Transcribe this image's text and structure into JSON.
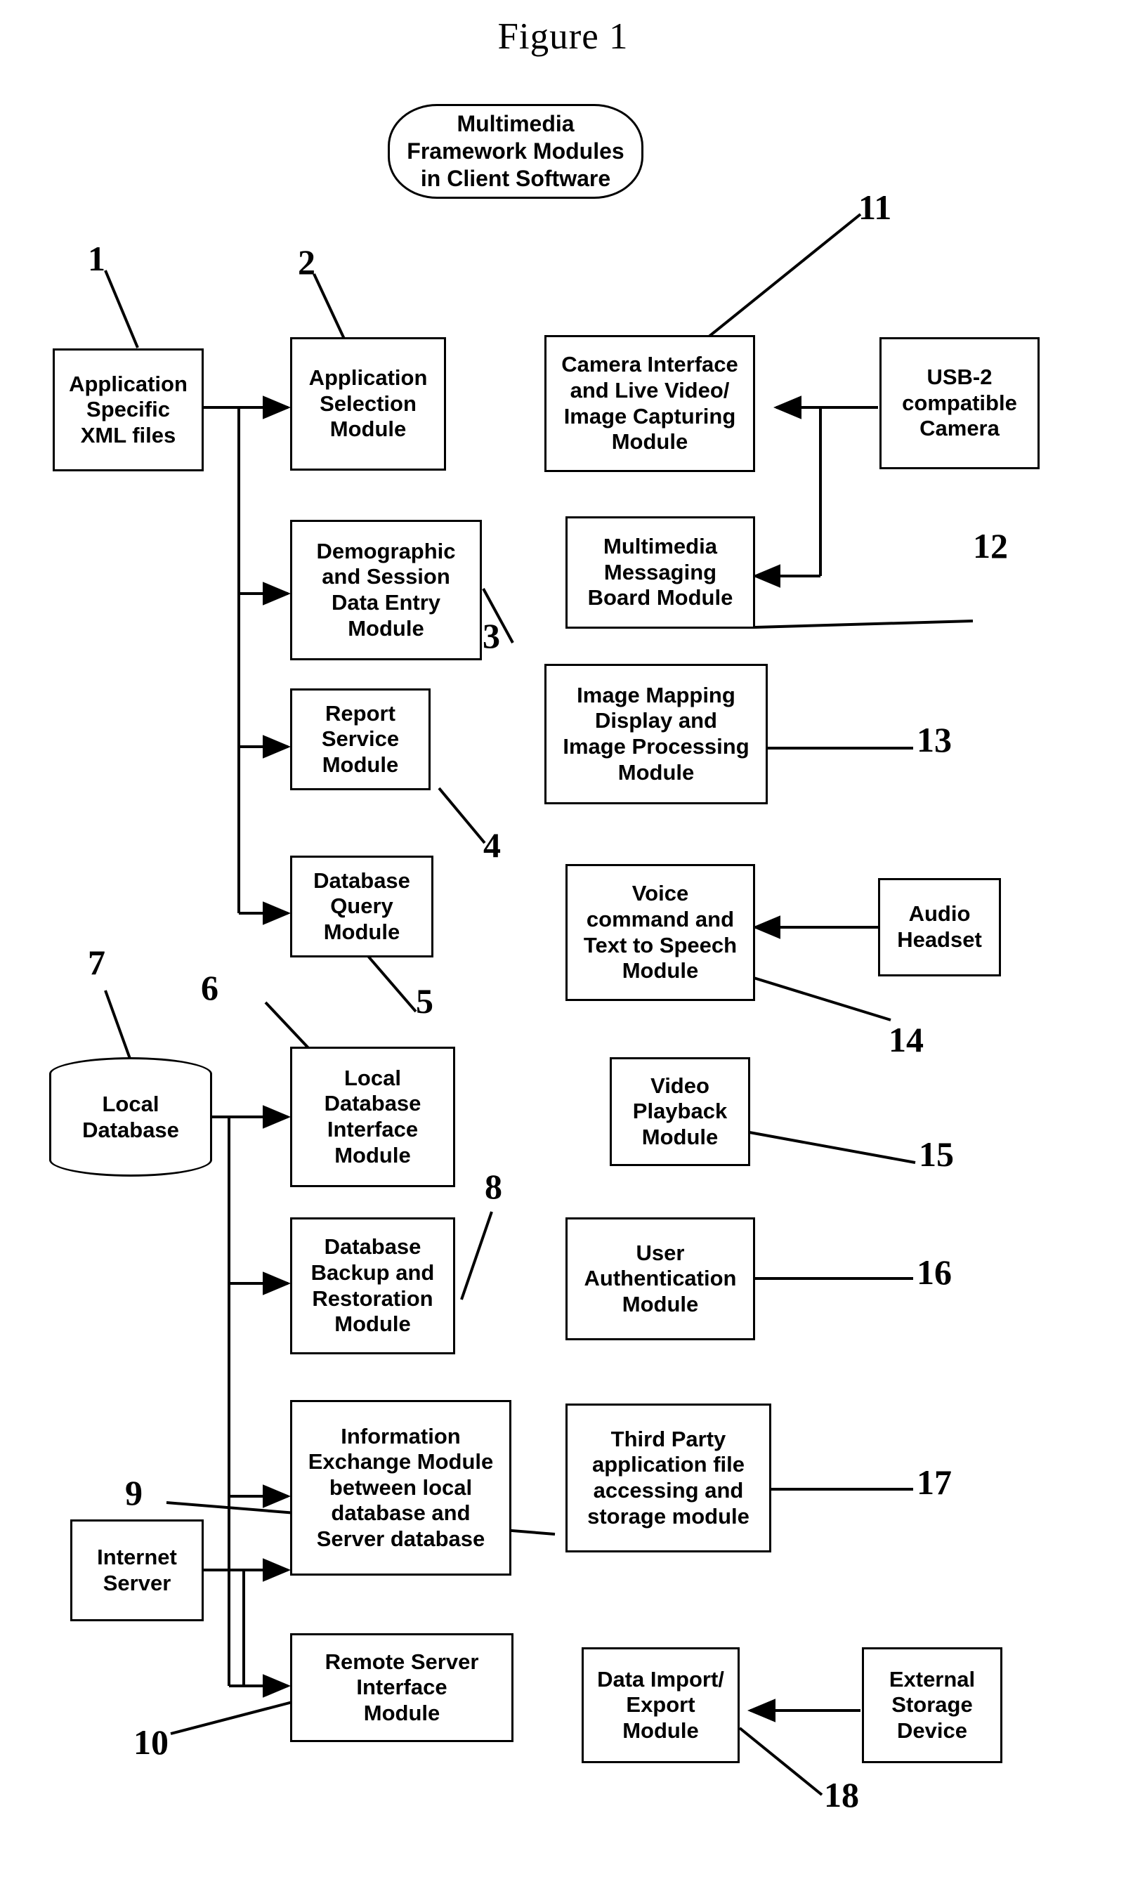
{
  "figure": {
    "title": "Figure 1"
  },
  "header_node": {
    "label": "Multimedia\nFramework Modules\nin Client Software"
  },
  "nodes": [
    {
      "id": "application-specific-xml-files",
      "label": "Application\nSpecific\nXML files",
      "shape": "rect"
    },
    {
      "id": "application-selection-module",
      "label": "Application\nSelection\nModule",
      "shape": "rect"
    },
    {
      "id": "demographic-and-session-data-entry-module",
      "label": "Demographic\nand Session\nData Entry\nModule",
      "shape": "rect"
    },
    {
      "id": "report-service-module",
      "label": "Report\nService\nModule",
      "shape": "rect"
    },
    {
      "id": "database-query-module",
      "label": "Database\nQuery\nModule",
      "shape": "rect"
    },
    {
      "id": "local-database",
      "label": "Local\nDatabase",
      "shape": "cylinder"
    },
    {
      "id": "local-database-interface-module",
      "label": "Local\nDatabase\nInterface\nModule",
      "shape": "rect"
    },
    {
      "id": "database-backup-and-restoration-module",
      "label": "Database\nBackup and\nRestoration\nModule",
      "shape": "rect"
    },
    {
      "id": "information-exchange-module",
      "label": "Information\nExchange Module\nbetween local\ndatabase and\nServer database",
      "shape": "rect"
    },
    {
      "id": "internet-server",
      "label": "Internet\nServer",
      "shape": "rect"
    },
    {
      "id": "remote-server-interface-module",
      "label": "Remote Server\nInterface\nModule",
      "shape": "rect"
    },
    {
      "id": "camera-interface-module",
      "label": "Camera Interface\nand Live Video/\nImage Capturing\nModule",
      "shape": "rect"
    },
    {
      "id": "usb-2-compatible-camera",
      "label": "USB-2\ncompatible\nCamera",
      "shape": "rect"
    },
    {
      "id": "multimedia-messaging-board-module",
      "label": "Multimedia\nMessaging\nBoard Module",
      "shape": "rect"
    },
    {
      "id": "image-mapping-display-and-image-processing-module",
      "label": "Image Mapping\nDisplay and\nImage Processing\nModule",
      "shape": "rect"
    },
    {
      "id": "voice-command-and-text-to-speech-module",
      "label": "Voice\ncommand and\nText to Speech\nModule",
      "shape": "rect"
    },
    {
      "id": "audio-headset",
      "label": "Audio\nHeadset",
      "shape": "rect"
    },
    {
      "id": "video-playback-module",
      "label": "Video\nPlayback\nModule",
      "shape": "rect"
    },
    {
      "id": "user-authentication-module",
      "label": "User\nAuthentication\nModule",
      "shape": "rect"
    },
    {
      "id": "third-party-application-file-module",
      "label": "Third Party\napplication file\naccessing and\nstorage module",
      "shape": "rect"
    },
    {
      "id": "data-import-export-module",
      "label": "Data Import/\nExport\nModule",
      "shape": "rect"
    },
    {
      "id": "external-storage-device",
      "label": "External\nStorage\nDevice",
      "shape": "rect"
    }
  ],
  "reference_numerals": [
    {
      "id": "ref-1",
      "value": "1",
      "target": "application-specific-xml-files"
    },
    {
      "id": "ref-2",
      "value": "2",
      "target": "application-selection-module"
    },
    {
      "id": "ref-3",
      "value": "3",
      "target": "demographic-and-session-data-entry-module"
    },
    {
      "id": "ref-4",
      "value": "4",
      "target": "report-service-module"
    },
    {
      "id": "ref-5",
      "value": "5",
      "target": "database-query-module"
    },
    {
      "id": "ref-6",
      "value": "6",
      "target": "local-database-interface-module"
    },
    {
      "id": "ref-7",
      "value": "7",
      "target": "local-database"
    },
    {
      "id": "ref-8",
      "value": "8",
      "target": "database-backup-and-restoration-module"
    },
    {
      "id": "ref-9",
      "value": "9",
      "target": "information-exchange-module"
    },
    {
      "id": "ref-10",
      "value": "10",
      "target": "remote-server-interface-module"
    },
    {
      "id": "ref-11",
      "value": "11",
      "target": "camera-interface-module"
    },
    {
      "id": "ref-12",
      "value": "12",
      "target": "multimedia-messaging-board-module"
    },
    {
      "id": "ref-13",
      "value": "13",
      "target": "image-mapping-display-and-image-processing-module"
    },
    {
      "id": "ref-14",
      "value": "14",
      "target": "voice-command-and-text-to-speech-module"
    },
    {
      "id": "ref-15",
      "value": "15",
      "target": "video-playback-module"
    },
    {
      "id": "ref-16",
      "value": "16",
      "target": "user-authentication-module"
    },
    {
      "id": "ref-17",
      "value": "17",
      "target": "third-party-application-file-module"
    },
    {
      "id": "ref-18",
      "value": "18",
      "target": "data-import-export-module"
    }
  ],
  "colors": {
    "ink": "#000000",
    "paper": "#ffffff"
  }
}
